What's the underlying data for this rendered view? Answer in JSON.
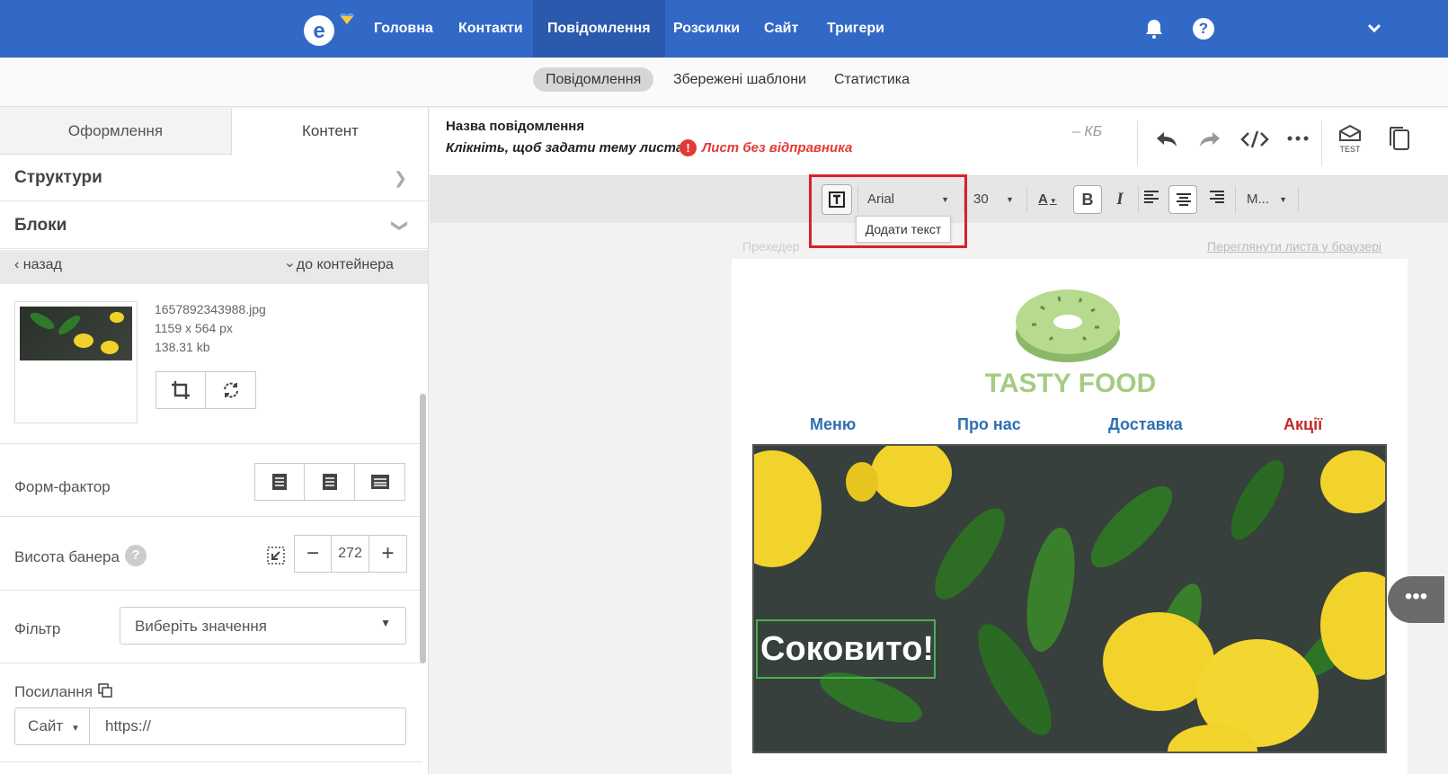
{
  "topnav": {
    "items": [
      {
        "label": "Головна"
      },
      {
        "label": "Контакти"
      },
      {
        "label": "Повідомлення"
      },
      {
        "label": "Розсилки"
      },
      {
        "label": "Сайт"
      },
      {
        "label": "Тригери"
      }
    ],
    "active_index": 2,
    "help_symbol": "?",
    "icons": [
      "logo-icon",
      "bell-icon",
      "help-icon",
      "chevron-down-icon"
    ]
  },
  "subnav": {
    "items": [
      {
        "label": "Повідомлення"
      },
      {
        "label": "Збережені шаблони"
      },
      {
        "label": "Статистика"
      }
    ],
    "active_index": 0
  },
  "left_panel": {
    "tabs": [
      {
        "label": "Оформлення"
      },
      {
        "label": "Контент"
      }
    ],
    "active_tab": 1,
    "sections": {
      "structures": "Структури",
      "blocks": "Блоки"
    },
    "back_label": "назад",
    "to_container_label": "до контейнера",
    "image": {
      "filename": "1657892343988.jpg",
      "dimensions": "1159 x 564 px",
      "size": "138.31 kb"
    },
    "form_factor_label": "Форм-фактор",
    "banner_height_label": "Висота банера",
    "banner_height_value": "272",
    "filter_label": "Фільтр",
    "filter_placeholder": "Виберіть значення",
    "link_label": "Посилання",
    "link_type": "Сайт",
    "link_url": "https://"
  },
  "message": {
    "title": "Назва повідомлення",
    "subject_prompt": "Клікніть, щоб задати тему листа",
    "warning": "Лист без відправника",
    "size": "– КБ",
    "test_label": "TEST"
  },
  "toolbar": {
    "font": "Arial",
    "size": "30",
    "more_label": "М...",
    "tooltip": "Додати текст"
  },
  "email": {
    "preheader": "Прехедер",
    "view_in_browser": "Переглянути листа у браузері",
    "brand": "TASTY FOOD",
    "nav_links": [
      {
        "label": "Меню",
        "color": "#2f6fb3"
      },
      {
        "label": "Про нас",
        "color": "#2f6fb3"
      },
      {
        "label": "Доставка",
        "color": "#2f6fb3"
      },
      {
        "label": "Акції",
        "color": "#c62828"
      }
    ],
    "banner_text": "Соковито!"
  },
  "colors": {
    "primary": "#3269c7",
    "warning": "#d9222a",
    "brand_green": "#a5cc82"
  }
}
